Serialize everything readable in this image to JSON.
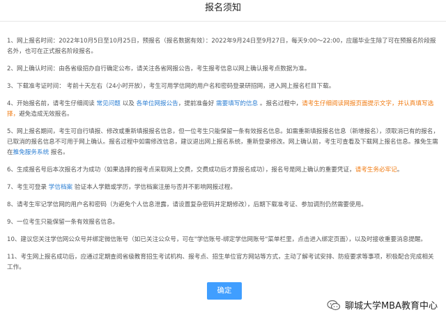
{
  "header": {
    "title": "报名须知"
  },
  "items": [
    {
      "text": "1、网上报名时间：2022年10月5日至10月25日，预报名（报名数据有效）：2022年9月24日至9月27日，每天9:00～22:00，应届毕业生除了可在预报名阶段报名外，也可在正式报名阶段报名。"
    },
    {
      "text": "2、网上确认时间：由各省级招办自行确定公布，请关注各省网报公告，考生报考信息以网上确认报考点数据为准。"
    },
    {
      "text": "3、下载准考证时间： 考前十天左右（24小时开放），考生可用学信网的用户名和密码登录研招网，进入网上报名栏目下载。"
    },
    {
      "pre": "4、开始报名前，请考生仔细阅读 ",
      "link1": "常见问题",
      "mid1": " 以及 ",
      "link2": "各单位网报公告",
      "mid2": "，提前准备好 ",
      "link3": "需要填写的信息",
      "mid3": " 。报名过程中，",
      "orange1": "请考生仔细阅读网报页面提示文字，并认真填写选择，",
      "post": "避免造成无效报名。"
    },
    {
      "pre": "5、网上报名期间，考生可自行填报、修改或重新填报报名信息，但一位考生只能保留一条有效报名信息。如需重新填报报名信息（新增报名），须取消已有的报名，已取消的报名信息不可用于网上确认。报名过程中如需修改信息，建议退出网上报名系统，重新登录修改。网上确认前，考生可查看及下载网上报名信息。推免生需在",
      "link1": "推免服务系统",
      "post": " 报名。"
    },
    {
      "pre": "6、生成报名号后本次报名才为成功（如果选择的报考点采取网上交费，交费成功后才算报名成功），报名号是网上确认的重要凭证，",
      "orange1": "请考生务必牢记",
      "post": "。"
    },
    {
      "pre": "7、考生可登录 ",
      "link1": "学信档案",
      "post": " 验证本人学籍或学历，学信档案注册与否并不影响网报过程。"
    },
    {
      "text": "8、请考生牢记学信网的用户名和密码（为避免个人信息泄露，请设置复杂密码并定期修改），后期下载准考证、参加调剂仍然需要使用。"
    },
    {
      "text": "9、一位考生只能保留一条有效报名信息。"
    },
    {
      "text": "10、建议您关注学信网公众号并绑定微信账号（如已关注公众号，可在\"学信账号-绑定学信网账号\"菜单栏里，点击进入绑定页面），以及时接收重要消息提醒。"
    },
    {
      "text": "11、考生网上报名成功后，应通过定期查阅省级教育招生考试机构、报考点、招生单位官方网站等方式，主动了解考试安排、防疫要求等事项，积极配合完成相关工作。"
    }
  ],
  "confirm_label": "确定",
  "watermark": {
    "text": "聊城大学MBA教育中心",
    "icon": "wechat-icon"
  },
  "colors": {
    "link": "#2d7fd3",
    "warning": "#f07a10",
    "button": "#409eff"
  }
}
